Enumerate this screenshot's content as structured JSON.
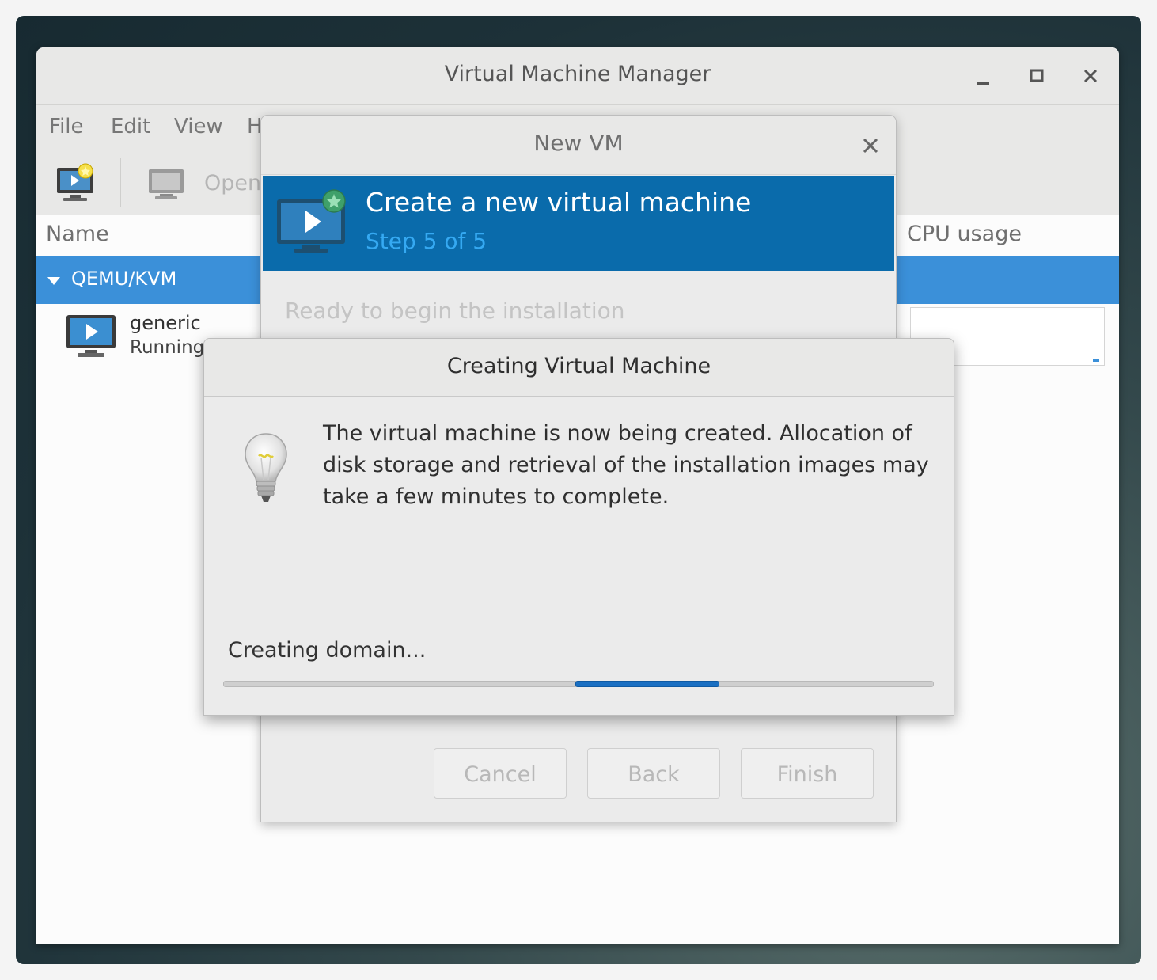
{
  "window": {
    "title": "Virtual Machine Manager",
    "controls": {
      "minimize": "‒",
      "maximize": "▫",
      "close": "✕"
    }
  },
  "menubar": {
    "items": [
      "File",
      "Edit",
      "View",
      "H"
    ]
  },
  "toolbar": {
    "open_label": "Open"
  },
  "columns": {
    "name": "Name",
    "cpu": "CPU usage"
  },
  "connection": {
    "label": "QEMU/KVM"
  },
  "vms": [
    {
      "name": "generic",
      "status": "Running"
    }
  ],
  "new_vm_dialog": {
    "title": "New VM",
    "close": "✕",
    "banner_title": "Create a new virtual machine",
    "banner_step": "Step 5 of 5",
    "ready_text": "Ready to begin the installation",
    "buttons": {
      "cancel": "Cancel",
      "back": "Back",
      "finish": "Finish"
    }
  },
  "creating_dialog": {
    "title": "Creating Virtual Machine",
    "message": "The virtual machine is now being created. Allocation of disk storage and retrieval of the installation images may take a few minutes to complete.",
    "status": "Creating domain...",
    "progress": "indeterminate"
  },
  "colors": {
    "selection": "#3b90d9",
    "banner": "#0a6bab",
    "banner_step": "#35a9f2",
    "progress": "#1a6fc2"
  },
  "icons": [
    "new-vm-icon",
    "monitor-icon",
    "vm-running-icon",
    "lightbulb-icon",
    "expander-arrow-icon"
  ]
}
